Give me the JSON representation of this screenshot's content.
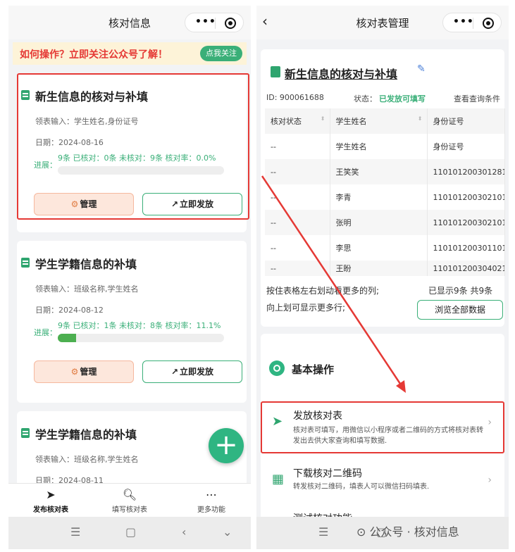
{
  "left": {
    "title": "核对信息",
    "banner": {
      "text": "如何操作？立即关注公众号了解！",
      "button": "点我关注"
    },
    "cards": [
      {
        "title": "新生信息的核对与补填",
        "fields_label": "领表输入：学生姓名,身份证号",
        "date_label": "日期：2024-08-16",
        "progress_label": "进展：",
        "progress_text": "9条 已核对：0条 未核对：9条 核对率：0.0%",
        "progress": 0.0,
        "manage": "管理",
        "send": "立即发放"
      },
      {
        "title": "学生学籍信息的补填",
        "fields_label": "领表输入：班级名称,学生姓名",
        "date_label": "日期：2024-08-12",
        "progress_label": "进展：",
        "progress_text": "9条 已核对：1条 未核对：8条 核对率：11.1%",
        "progress": 0.111,
        "manage": "管理",
        "send": "立即发放"
      },
      {
        "title": "学生学籍信息的补填",
        "fields_label": "领表输入：班级名称,学生姓名",
        "date_label": "日期：2024-08-11"
      }
    ],
    "fab": "+",
    "tabs": [
      {
        "label": "发布核对表",
        "icon": "send-icon"
      },
      {
        "label": "填写核对表",
        "icon": "search-icon"
      },
      {
        "label": "更多功能",
        "icon": "more-icon"
      }
    ]
  },
  "right": {
    "title": "核对表管理",
    "sheet_title": "新生信息的核对与补填",
    "id_text": "ID: 900061688",
    "status_label": "状态：",
    "status_value": "已发放可填写",
    "query_link": "查看查询条件",
    "table": {
      "headers": [
        "核对状态",
        "学生姓名",
        "身份证号"
      ],
      "rows": [
        [
          "--",
          "学生姓名",
          "身份证号"
        ],
        [
          "--",
          "王笑笑",
          "110101200301281"
        ],
        [
          "--",
          "李青",
          "110101200302101"
        ],
        [
          "--",
          "张明",
          "110101200302101"
        ],
        [
          "--",
          "李思",
          "110101200301101"
        ],
        [
          "--",
          "王盼",
          "110101200304021"
        ]
      ]
    },
    "hint1": "按住表格左右划动看更多的列;",
    "hint2": "向上划可显示更多行;",
    "shown": "已显示9条 共9条",
    "browse": "浏览全部数据",
    "ops_title": "基本操作",
    "ops": [
      {
        "title": "发放核对表",
        "desc": "核对表可填写，用微信以小程序或者二维码的方式将核对表转发出去供大家查询和填写数据."
      },
      {
        "title": "下载核对二维码",
        "desc": "转发核对二维码，填表人可以微信扫码填表."
      },
      {
        "title": "测试核对功能"
      }
    ]
  },
  "watermark": "公众号 · 核对信息",
  "colors": {
    "accent": "#3aaf78",
    "alert": "#e53935",
    "warm": "#fde7dc"
  }
}
